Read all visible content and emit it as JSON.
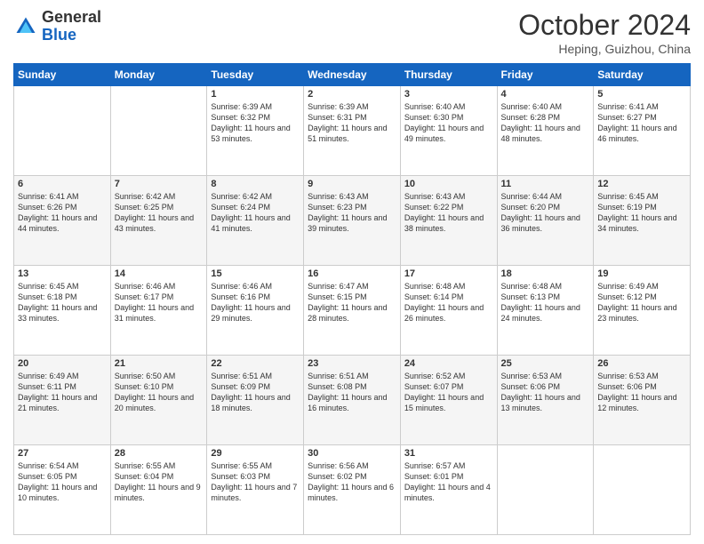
{
  "header": {
    "logo_line1": "General",
    "logo_line2": "Blue",
    "month": "October 2024",
    "location": "Heping, Guizhou, China"
  },
  "weekdays": [
    "Sunday",
    "Monday",
    "Tuesday",
    "Wednesday",
    "Thursday",
    "Friday",
    "Saturday"
  ],
  "weeks": [
    [
      {
        "day": "",
        "sunrise": "",
        "sunset": "",
        "daylight": ""
      },
      {
        "day": "",
        "sunrise": "",
        "sunset": "",
        "daylight": ""
      },
      {
        "day": "1",
        "sunrise": "Sunrise: 6:39 AM",
        "sunset": "Sunset: 6:32 PM",
        "daylight": "Daylight: 11 hours and 53 minutes."
      },
      {
        "day": "2",
        "sunrise": "Sunrise: 6:39 AM",
        "sunset": "Sunset: 6:31 PM",
        "daylight": "Daylight: 11 hours and 51 minutes."
      },
      {
        "day": "3",
        "sunrise": "Sunrise: 6:40 AM",
        "sunset": "Sunset: 6:30 PM",
        "daylight": "Daylight: 11 hours and 49 minutes."
      },
      {
        "day": "4",
        "sunrise": "Sunrise: 6:40 AM",
        "sunset": "Sunset: 6:28 PM",
        "daylight": "Daylight: 11 hours and 48 minutes."
      },
      {
        "day": "5",
        "sunrise": "Sunrise: 6:41 AM",
        "sunset": "Sunset: 6:27 PM",
        "daylight": "Daylight: 11 hours and 46 minutes."
      }
    ],
    [
      {
        "day": "6",
        "sunrise": "Sunrise: 6:41 AM",
        "sunset": "Sunset: 6:26 PM",
        "daylight": "Daylight: 11 hours and 44 minutes."
      },
      {
        "day": "7",
        "sunrise": "Sunrise: 6:42 AM",
        "sunset": "Sunset: 6:25 PM",
        "daylight": "Daylight: 11 hours and 43 minutes."
      },
      {
        "day": "8",
        "sunrise": "Sunrise: 6:42 AM",
        "sunset": "Sunset: 6:24 PM",
        "daylight": "Daylight: 11 hours and 41 minutes."
      },
      {
        "day": "9",
        "sunrise": "Sunrise: 6:43 AM",
        "sunset": "Sunset: 6:23 PM",
        "daylight": "Daylight: 11 hours and 39 minutes."
      },
      {
        "day": "10",
        "sunrise": "Sunrise: 6:43 AM",
        "sunset": "Sunset: 6:22 PM",
        "daylight": "Daylight: 11 hours and 38 minutes."
      },
      {
        "day": "11",
        "sunrise": "Sunrise: 6:44 AM",
        "sunset": "Sunset: 6:20 PM",
        "daylight": "Daylight: 11 hours and 36 minutes."
      },
      {
        "day": "12",
        "sunrise": "Sunrise: 6:45 AM",
        "sunset": "Sunset: 6:19 PM",
        "daylight": "Daylight: 11 hours and 34 minutes."
      }
    ],
    [
      {
        "day": "13",
        "sunrise": "Sunrise: 6:45 AM",
        "sunset": "Sunset: 6:18 PM",
        "daylight": "Daylight: 11 hours and 33 minutes."
      },
      {
        "day": "14",
        "sunrise": "Sunrise: 6:46 AM",
        "sunset": "Sunset: 6:17 PM",
        "daylight": "Daylight: 11 hours and 31 minutes."
      },
      {
        "day": "15",
        "sunrise": "Sunrise: 6:46 AM",
        "sunset": "Sunset: 6:16 PM",
        "daylight": "Daylight: 11 hours and 29 minutes."
      },
      {
        "day": "16",
        "sunrise": "Sunrise: 6:47 AM",
        "sunset": "Sunset: 6:15 PM",
        "daylight": "Daylight: 11 hours and 28 minutes."
      },
      {
        "day": "17",
        "sunrise": "Sunrise: 6:48 AM",
        "sunset": "Sunset: 6:14 PM",
        "daylight": "Daylight: 11 hours and 26 minutes."
      },
      {
        "day": "18",
        "sunrise": "Sunrise: 6:48 AM",
        "sunset": "Sunset: 6:13 PM",
        "daylight": "Daylight: 11 hours and 24 minutes."
      },
      {
        "day": "19",
        "sunrise": "Sunrise: 6:49 AM",
        "sunset": "Sunset: 6:12 PM",
        "daylight": "Daylight: 11 hours and 23 minutes."
      }
    ],
    [
      {
        "day": "20",
        "sunrise": "Sunrise: 6:49 AM",
        "sunset": "Sunset: 6:11 PM",
        "daylight": "Daylight: 11 hours and 21 minutes."
      },
      {
        "day": "21",
        "sunrise": "Sunrise: 6:50 AM",
        "sunset": "Sunset: 6:10 PM",
        "daylight": "Daylight: 11 hours and 20 minutes."
      },
      {
        "day": "22",
        "sunrise": "Sunrise: 6:51 AM",
        "sunset": "Sunset: 6:09 PM",
        "daylight": "Daylight: 11 hours and 18 minutes."
      },
      {
        "day": "23",
        "sunrise": "Sunrise: 6:51 AM",
        "sunset": "Sunset: 6:08 PM",
        "daylight": "Daylight: 11 hours and 16 minutes."
      },
      {
        "day": "24",
        "sunrise": "Sunrise: 6:52 AM",
        "sunset": "Sunset: 6:07 PM",
        "daylight": "Daylight: 11 hours and 15 minutes."
      },
      {
        "day": "25",
        "sunrise": "Sunrise: 6:53 AM",
        "sunset": "Sunset: 6:06 PM",
        "daylight": "Daylight: 11 hours and 13 minutes."
      },
      {
        "day": "26",
        "sunrise": "Sunrise: 6:53 AM",
        "sunset": "Sunset: 6:06 PM",
        "daylight": "Daylight: 11 hours and 12 minutes."
      }
    ],
    [
      {
        "day": "27",
        "sunrise": "Sunrise: 6:54 AM",
        "sunset": "Sunset: 6:05 PM",
        "daylight": "Daylight: 11 hours and 10 minutes."
      },
      {
        "day": "28",
        "sunrise": "Sunrise: 6:55 AM",
        "sunset": "Sunset: 6:04 PM",
        "daylight": "Daylight: 11 hours and 9 minutes."
      },
      {
        "day": "29",
        "sunrise": "Sunrise: 6:55 AM",
        "sunset": "Sunset: 6:03 PM",
        "daylight": "Daylight: 11 hours and 7 minutes."
      },
      {
        "day": "30",
        "sunrise": "Sunrise: 6:56 AM",
        "sunset": "Sunset: 6:02 PM",
        "daylight": "Daylight: 11 hours and 6 minutes."
      },
      {
        "day": "31",
        "sunrise": "Sunrise: 6:57 AM",
        "sunset": "Sunset: 6:01 PM",
        "daylight": "Daylight: 11 hours and 4 minutes."
      },
      {
        "day": "",
        "sunrise": "",
        "sunset": "",
        "daylight": ""
      },
      {
        "day": "",
        "sunrise": "",
        "sunset": "",
        "daylight": ""
      }
    ]
  ]
}
